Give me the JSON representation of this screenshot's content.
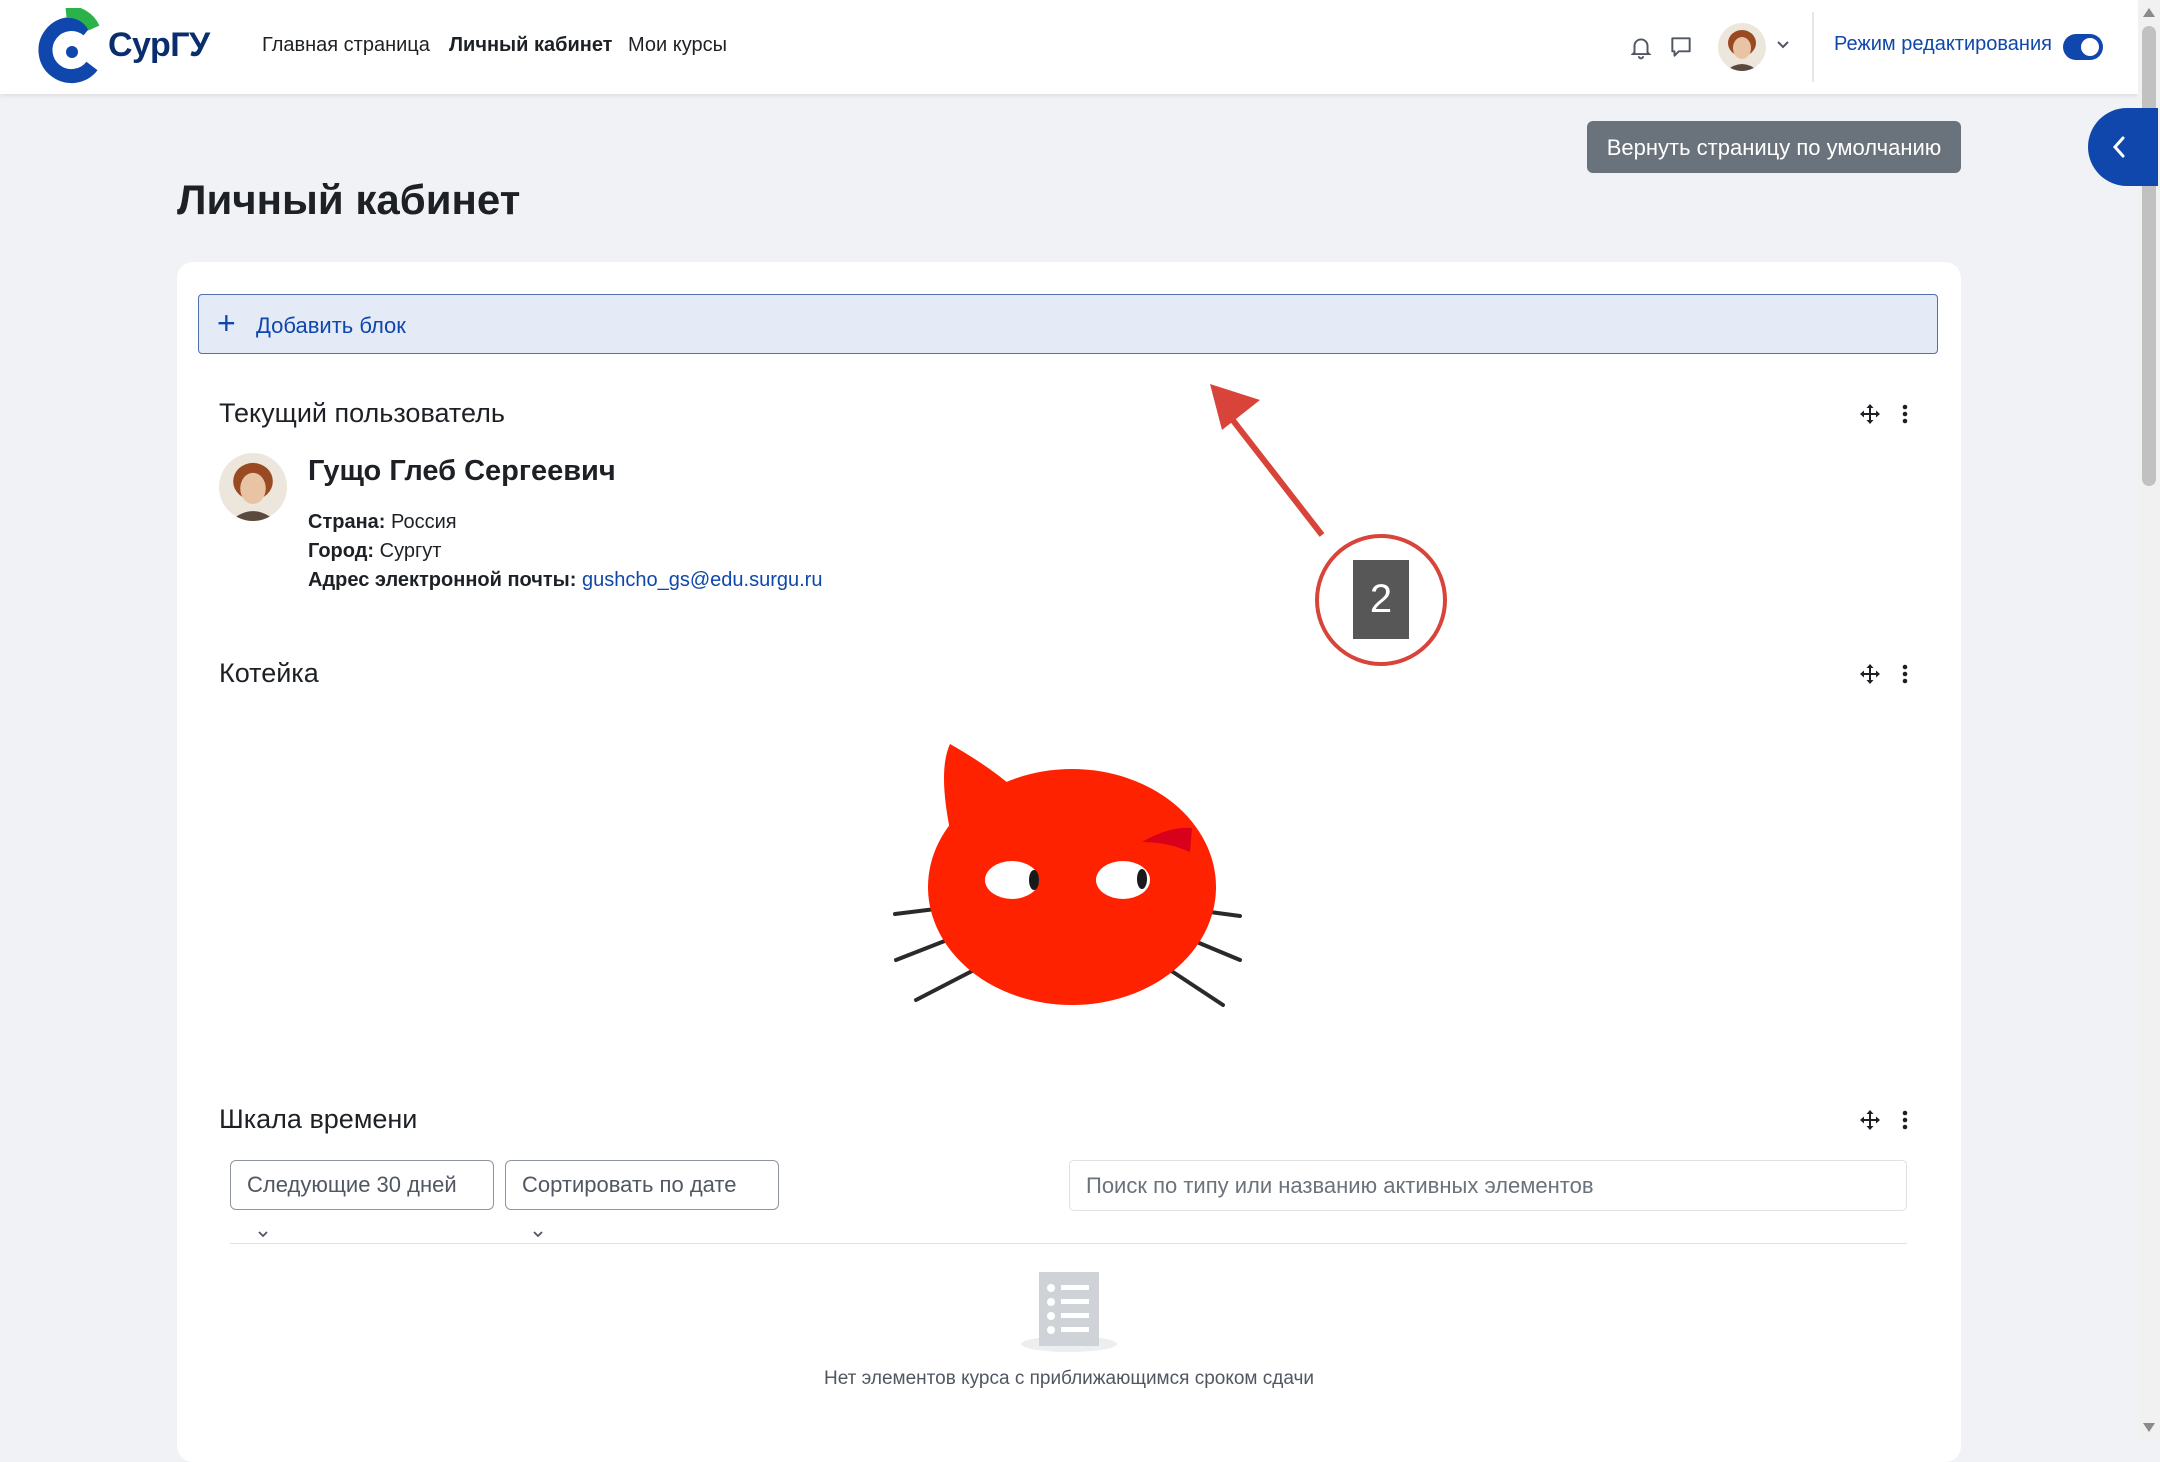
{
  "navbar": {
    "logo_text": "СурГУ",
    "links": [
      {
        "label": "Главная страница",
        "active": false
      },
      {
        "label": "Личный кабинет",
        "active": true
      },
      {
        "label": "Мои курсы",
        "active": false
      }
    ],
    "edit_mode_label": "Режим редактирования",
    "edit_mode_on": true
  },
  "page": {
    "reset_button": "Вернуть страницу по умолчанию",
    "title": "Личный кабинет",
    "add_block": "Добавить блок"
  },
  "user_block": {
    "title": "Текущий пользователь",
    "name": "Гущо Глеб Сергеевич",
    "country_label": "Страна:",
    "country": "Россия",
    "city_label": "Город:",
    "city": "Сургут",
    "email_label": "Адрес электронной почты:",
    "email": "gushcho_gs@edu.surgu.ru"
  },
  "cat_block": {
    "title": "Котейка"
  },
  "annotation": {
    "step": "2"
  },
  "timeline": {
    "title": "Шкала времени",
    "range_select": "Следующие 30 дней",
    "sort_select": "Сортировать по дате",
    "search_placeholder": "Поиск по типу или названию активных элементов",
    "empty_text": "Нет элементов курса с приближающимся сроком сдачи"
  },
  "colors": {
    "brand": "#0f47ad",
    "logo_green": "#2bb34a",
    "annotation": "#d9443a",
    "cat_red": "#ff2200"
  }
}
